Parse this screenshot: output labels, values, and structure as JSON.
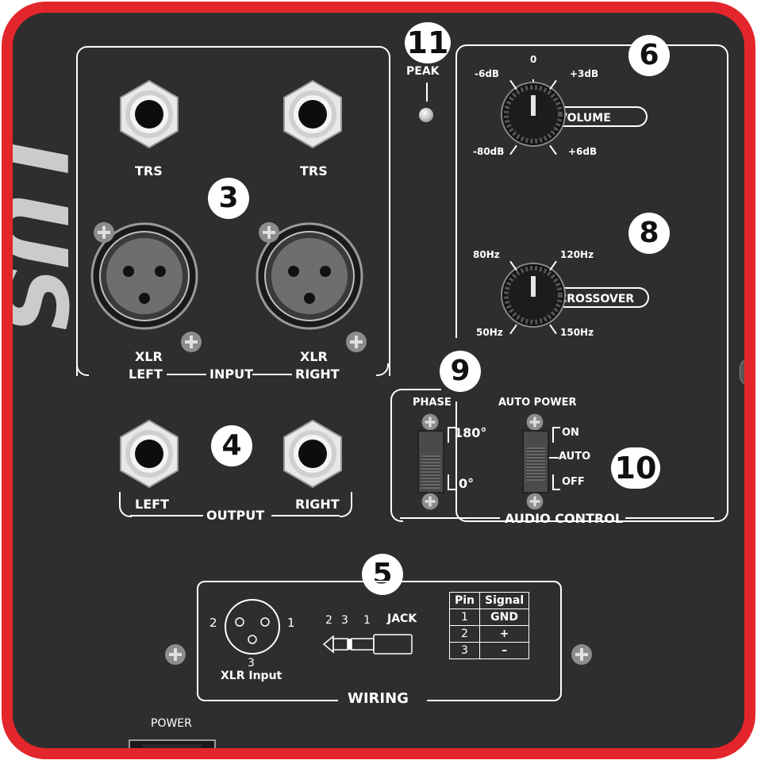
{
  "brand": {
    "text": "LUS"
  },
  "callouts": {
    "input": "3",
    "output": "4",
    "wiring": "5",
    "volume": "6",
    "crossover": "8",
    "phase": "9",
    "auto_power": "10",
    "peak": "11"
  },
  "peak": {
    "label": "PEAK"
  },
  "input": {
    "group_label": "INPUT",
    "left_label": "LEFT",
    "right_label": "RIGHT",
    "trs_left": "TRS",
    "trs_right": "TRS",
    "xlr_left": "XLR",
    "xlr_right": "XLR"
  },
  "output": {
    "group_label": "OUTPUT",
    "left_label": "LEFT",
    "right_label": "RIGHT"
  },
  "volume": {
    "label": "VOLUME",
    "scale": {
      "top": "0",
      "upper_left": "-6dB",
      "upper_right": "+3dB",
      "lower_left": "-80dB",
      "lower_right": "+6dB"
    }
  },
  "crossover": {
    "label": "CROSSOVER",
    "scale": {
      "upper_left": "80Hz",
      "upper_right": "120Hz",
      "lower_left": "50Hz",
      "lower_right": "150Hz"
    }
  },
  "audio_control": {
    "group_label": "AUDIO CONTROL",
    "phase": {
      "label": "PHASE",
      "options": [
        "180°",
        "0°"
      ]
    },
    "auto_power": {
      "label": "AUTO POWER",
      "options": [
        "ON",
        "AUTO",
        "OFF"
      ]
    }
  },
  "wiring": {
    "group_label": "WIRING",
    "xlr_caption": "XLR Input",
    "xlr_pins": {
      "left": "2",
      "right": "1",
      "bottom": "3"
    },
    "jack_label": "JACK",
    "jack_pins": [
      "2",
      "3",
      "1"
    ],
    "table": {
      "headers": [
        "Pin",
        "Signal"
      ],
      "rows": [
        [
          "1",
          "GND"
        ],
        [
          "2",
          "+"
        ],
        [
          "3",
          "–"
        ]
      ]
    }
  },
  "power": {
    "label": "POWER"
  },
  "colors": {
    "frame": "#e3262b",
    "panel": "#2e2e2e",
    "text": "#ffffff"
  }
}
